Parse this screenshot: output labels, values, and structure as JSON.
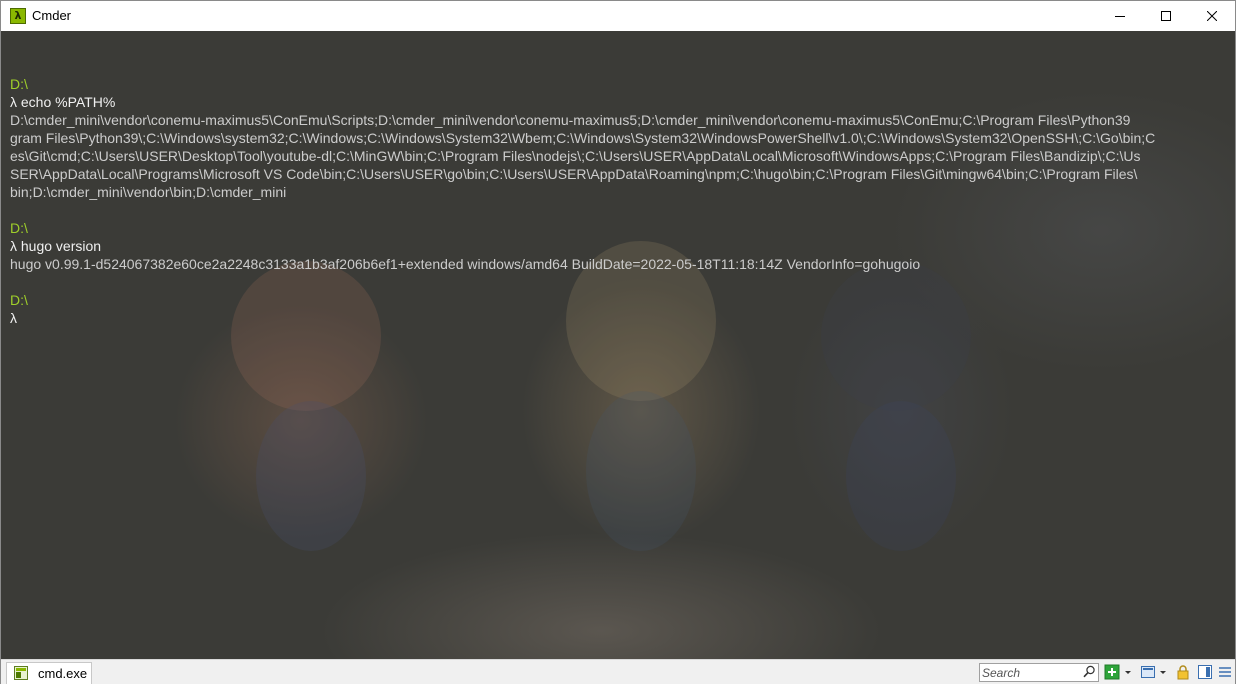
{
  "window": {
    "title": "Cmder",
    "app_icon_glyph": "λ"
  },
  "console": {
    "lines": [
      {
        "type": "blank",
        "text": ""
      },
      {
        "type": "path",
        "text": "D:\\"
      },
      {
        "type": "cmd",
        "text": "λ echo %PATH%"
      },
      {
        "type": "out",
        "text": "D:\\cmder_mini\\vendor\\conemu-maximus5\\ConEmu\\Scripts;D:\\cmder_mini\\vendor\\conemu-maximus5;D:\\cmder_mini\\vendor\\conemu-maximus5\\ConEmu;C:\\Program Files\\Python39"
      },
      {
        "type": "out",
        "text": "gram Files\\Python39\\;C:\\Windows\\system32;C:\\Windows;C:\\Windows\\System32\\Wbem;C:\\Windows\\System32\\WindowsPowerShell\\v1.0\\;C:\\Windows\\System32\\OpenSSH\\;C:\\Go\\bin;C"
      },
      {
        "type": "out",
        "text": "es\\Git\\cmd;C:\\Users\\USER\\Desktop\\Tool\\youtube-dl;C:\\MinGW\\bin;C:\\Program Files\\nodejs\\;C:\\Users\\USER\\AppData\\Local\\Microsoft\\WindowsApps;C:\\Program Files\\Bandizip\\;C:\\Us"
      },
      {
        "type": "out",
        "text": "SER\\AppData\\Local\\Programs\\Microsoft VS Code\\bin;C:\\Users\\USER\\go\\bin;C:\\Users\\USER\\AppData\\Roaming\\npm;C:\\hugo\\bin;C:\\Program Files\\Git\\mingw64\\bin;C:\\Program Files\\"
      },
      {
        "type": "out",
        "text": "bin;D:\\cmder_mini\\vendor\\bin;D:\\cmder_mini"
      },
      {
        "type": "blank",
        "text": ""
      },
      {
        "type": "path",
        "text": "D:\\"
      },
      {
        "type": "cmd",
        "text": "λ hugo version"
      },
      {
        "type": "out",
        "text": "hugo v0.99.1-d524067382e60ce2a2248c3133a1b3af206b6ef1+extended windows/amd64 BuildDate=2022-05-18T11:18:14Z VendorInfo=gohugoio"
      },
      {
        "type": "blank",
        "text": ""
      },
      {
        "type": "path",
        "text": "D:\\"
      },
      {
        "type": "cmd",
        "text": "λ"
      }
    ]
  },
  "statusbar": {
    "tab_label": "cmd.exe",
    "search_placeholder": "Search"
  },
  "colors": {
    "console_bg": "#3b3b37",
    "path_green": "#9fcf2a",
    "text": "#d8d8d8"
  },
  "icons": [
    "lambda-icon",
    "minimize-icon",
    "maximize-icon",
    "close-icon",
    "cmd-tab-icon",
    "search-icon",
    "new-console-icon",
    "dropdown-icon",
    "split-view-icon",
    "lock-icon",
    "panel-icon",
    "menu-icon"
  ]
}
